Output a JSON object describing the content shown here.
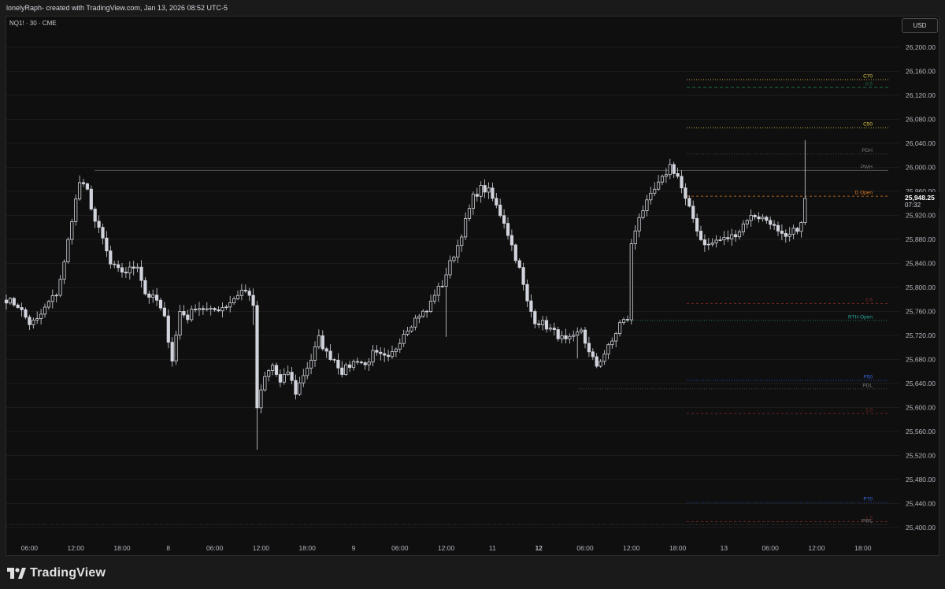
{
  "header": {
    "text": "lonelyRaph- created with TradingView.com, Jan 13, 2026 08:52 UTC-5"
  },
  "symbol": {
    "text": "NQ1! · 30 · CME"
  },
  "currency": {
    "label": "USD"
  },
  "footer": {
    "brand": "TradingView"
  },
  "colors": {
    "candle": "#d1d4dc",
    "grid": "#1c1c1c",
    "axis_text": "#b2b5be"
  },
  "chart_data": {
    "type": "candlestick",
    "y_ticks": [
      25400,
      25440,
      25480,
      25520,
      25560,
      25600,
      25640,
      25680,
      25720,
      25760,
      25800,
      25840,
      25880,
      25920,
      25960,
      26000,
      26040,
      26080,
      26120,
      26160,
      26200
    ],
    "ylim": [
      25388,
      26228
    ],
    "x_ticks": [
      {
        "label": "06:00",
        "bar": 6
      },
      {
        "label": "12:00",
        "bar": 18
      },
      {
        "label": "18:00",
        "bar": 30
      },
      {
        "label": "8",
        "bar": 42
      },
      {
        "label": "06:00",
        "bar": 54
      },
      {
        "label": "12:00",
        "bar": 66
      },
      {
        "label": "18:00",
        "bar": 78
      },
      {
        "label": "9",
        "bar": 90
      },
      {
        "label": "06:00",
        "bar": 102
      },
      {
        "label": "12:00",
        "bar": 114
      },
      {
        "label": "11",
        "bar": 126
      },
      {
        "label": "12",
        "bar": 138,
        "bold": true
      },
      {
        "label": "06:00",
        "bar": 150
      },
      {
        "label": "12:00",
        "bar": 162
      },
      {
        "label": "18:00",
        "bar": 174
      },
      {
        "label": "13",
        "bar": 186
      },
      {
        "label": "06:00",
        "bar": 198
      },
      {
        "label": "12:00",
        "bar": 210
      },
      {
        "label": "18:00",
        "bar": 222
      }
    ],
    "last_price": {
      "value": 25948.25,
      "label": "25,948.25",
      "countdown": "07:32"
    },
    "levels": [
      {
        "label": "C70",
        "price": 26146,
        "color": "#e6c84a",
        "dash": "1,2",
        "label_color": "#e6c84a"
      },
      {
        "label": "0.5",
        "price": 26133,
        "color": "#1f8a5c",
        "dash": "4,3",
        "label_color": "#1f6d4a"
      },
      {
        "label": "C50",
        "price": 26066,
        "color": "#e6c84a",
        "dash": "1,2",
        "label_color": "#e6c84a"
      },
      {
        "label": "PDH",
        "price": 26022,
        "color": "#5a5a5a",
        "dash": "1,2",
        "label_color": "#7a7a7a"
      },
      {
        "label": "PWH",
        "price": 25995,
        "color": "#5a5a5a",
        "dash": "",
        "label_color": "#7a7a7a"
      },
      {
        "label": "D Open",
        "price": 25952,
        "color": "#e07a22",
        "dash": "3,3",
        "label_color": "#e07a22"
      },
      {
        "label": "0.5",
        "price": 25773,
        "color": "#8a2a2a",
        "dash": "3,3",
        "label_color": "#7a2a2a"
      },
      {
        "label": "RTH Open",
        "price": 25745,
        "color": "#1f8a5c",
        "dash": "1,2",
        "label_color": "#26a69a"
      },
      {
        "label": "P50",
        "price": 25645,
        "color": "#2a4fd6",
        "dash": "1,2",
        "label_color": "#3a6ae8"
      },
      {
        "label": "PDL",
        "price": 25631,
        "color": "#5a5a5a",
        "dash": "1,2",
        "label_color": "#7a7a7a"
      },
      {
        "label": "1.0",
        "price": 25590,
        "color": "#8a2a2a",
        "dash": "3,3",
        "label_color": "#7a2a2a"
      },
      {
        "label": "P70",
        "price": 25442,
        "color": "#2a4fd6",
        "dash": "1,2",
        "label_color": "#3a6ae8"
      },
      {
        "label": "1.5",
        "price": 25410,
        "color": "#8a2a2a",
        "dash": "3,3",
        "label_color": "#7a2a2a"
      },
      {
        "label": "PWL",
        "price": 25405,
        "color": "#4a4a4a",
        "dash": "1,2",
        "label_color": "#7a7a7a"
      }
    ],
    "anchors": [
      {
        "bar": 0,
        "price": 25780
      },
      {
        "bar": 3,
        "price": 25770
      },
      {
        "bar": 6,
        "price": 25740
      },
      {
        "bar": 8,
        "price": 25745
      },
      {
        "bar": 11,
        "price": 25775
      },
      {
        "bar": 13,
        "price": 25790
      },
      {
        "bar": 15,
        "price": 25840
      },
      {
        "bar": 17,
        "price": 25915
      },
      {
        "bar": 19,
        "price": 25975
      },
      {
        "bar": 21,
        "price": 25960
      },
      {
        "bar": 23,
        "price": 25910
      },
      {
        "bar": 25,
        "price": 25880
      },
      {
        "bar": 27,
        "price": 25838
      },
      {
        "bar": 29,
        "price": 25828
      },
      {
        "bar": 31,
        "price": 25826
      },
      {
        "bar": 34,
        "price": 25838
      },
      {
        "bar": 36,
        "price": 25790
      },
      {
        "bar": 39,
        "price": 25778
      },
      {
        "bar": 41,
        "price": 25748
      },
      {
        "bar": 43,
        "price": 25680
      },
      {
        "bar": 45,
        "price": 25760
      },
      {
        "bar": 47,
        "price": 25750
      },
      {
        "bar": 49,
        "price": 25768
      },
      {
        "bar": 51,
        "price": 25765
      },
      {
        "bar": 53,
        "price": 25760
      },
      {
        "bar": 55,
        "price": 25765
      },
      {
        "bar": 57,
        "price": 25770
      },
      {
        "bar": 59,
        "price": 25782
      },
      {
        "bar": 61,
        "price": 25795
      },
      {
        "bar": 63,
        "price": 25790
      },
      {
        "bar": 64,
        "price": 25765
      },
      {
        "bar": 65,
        "price": 25600
      },
      {
        "bar": 67,
        "price": 25650
      },
      {
        "bar": 69,
        "price": 25670
      },
      {
        "bar": 71,
        "price": 25640
      },
      {
        "bar": 73,
        "price": 25660
      },
      {
        "bar": 75,
        "price": 25625
      },
      {
        "bar": 77,
        "price": 25655
      },
      {
        "bar": 79,
        "price": 25680
      },
      {
        "bar": 81,
        "price": 25715
      },
      {
        "bar": 83,
        "price": 25690
      },
      {
        "bar": 85,
        "price": 25680
      },
      {
        "bar": 87,
        "price": 25660
      },
      {
        "bar": 89,
        "price": 25670
      },
      {
        "bar": 91,
        "price": 25680
      },
      {
        "bar": 93,
        "price": 25670
      },
      {
        "bar": 95,
        "price": 25690
      },
      {
        "bar": 97,
        "price": 25685
      },
      {
        "bar": 99,
        "price": 25680
      },
      {
        "bar": 101,
        "price": 25700
      },
      {
        "bar": 103,
        "price": 25725
      },
      {
        "bar": 105,
        "price": 25740
      },
      {
        "bar": 107,
        "price": 25755
      },
      {
        "bar": 109,
        "price": 25760
      },
      {
        "bar": 111,
        "price": 25790
      },
      {
        "bar": 113,
        "price": 25805
      },
      {
        "bar": 115,
        "price": 25840
      },
      {
        "bar": 117,
        "price": 25870
      },
      {
        "bar": 119,
        "price": 25910
      },
      {
        "bar": 121,
        "price": 25950
      },
      {
        "bar": 123,
        "price": 25965
      },
      {
        "bar": 125,
        "price": 25960
      },
      {
        "bar": 127,
        "price": 25935
      },
      {
        "bar": 129,
        "price": 25910
      },
      {
        "bar": 131,
        "price": 25870
      },
      {
        "bar": 133,
        "price": 25830
      },
      {
        "bar": 135,
        "price": 25775
      },
      {
        "bar": 137,
        "price": 25745
      },
      {
        "bar": 139,
        "price": 25740
      },
      {
        "bar": 141,
        "price": 25730
      },
      {
        "bar": 143,
        "price": 25720
      },
      {
        "bar": 145,
        "price": 25710
      },
      {
        "bar": 147,
        "price": 25715
      },
      {
        "bar": 149,
        "price": 25730
      },
      {
        "bar": 151,
        "price": 25690
      },
      {
        "bar": 153,
        "price": 25670
      },
      {
        "bar": 155,
        "price": 25690
      },
      {
        "bar": 157,
        "price": 25710
      },
      {
        "bar": 159,
        "price": 25740
      },
      {
        "bar": 161,
        "price": 25748
      },
      {
        "bar": 162,
        "price": 25870
      },
      {
        "bar": 164,
        "price": 25920
      },
      {
        "bar": 166,
        "price": 25940
      },
      {
        "bar": 168,
        "price": 25962
      },
      {
        "bar": 170,
        "price": 25980
      },
      {
        "bar": 172,
        "price": 26003
      },
      {
        "bar": 174,
        "price": 25985
      },
      {
        "bar": 176,
        "price": 25945
      },
      {
        "bar": 178,
        "price": 25915
      },
      {
        "bar": 180,
        "price": 25880
      },
      {
        "bar": 182,
        "price": 25870
      },
      {
        "bar": 184,
        "price": 25878
      },
      {
        "bar": 186,
        "price": 25880
      },
      {
        "bar": 188,
        "price": 25885
      },
      {
        "bar": 190,
        "price": 25895
      },
      {
        "bar": 192,
        "price": 25915
      },
      {
        "bar": 194,
        "price": 25920
      },
      {
        "bar": 196,
        "price": 25915
      },
      {
        "bar": 198,
        "price": 25910
      },
      {
        "bar": 200,
        "price": 25890
      },
      {
        "bar": 202,
        "price": 25880
      },
      {
        "bar": 204,
        "price": 25893
      },
      {
        "bar": 206,
        "price": 25905
      },
      {
        "bar": 207,
        "price": 25948
      }
    ]
  }
}
